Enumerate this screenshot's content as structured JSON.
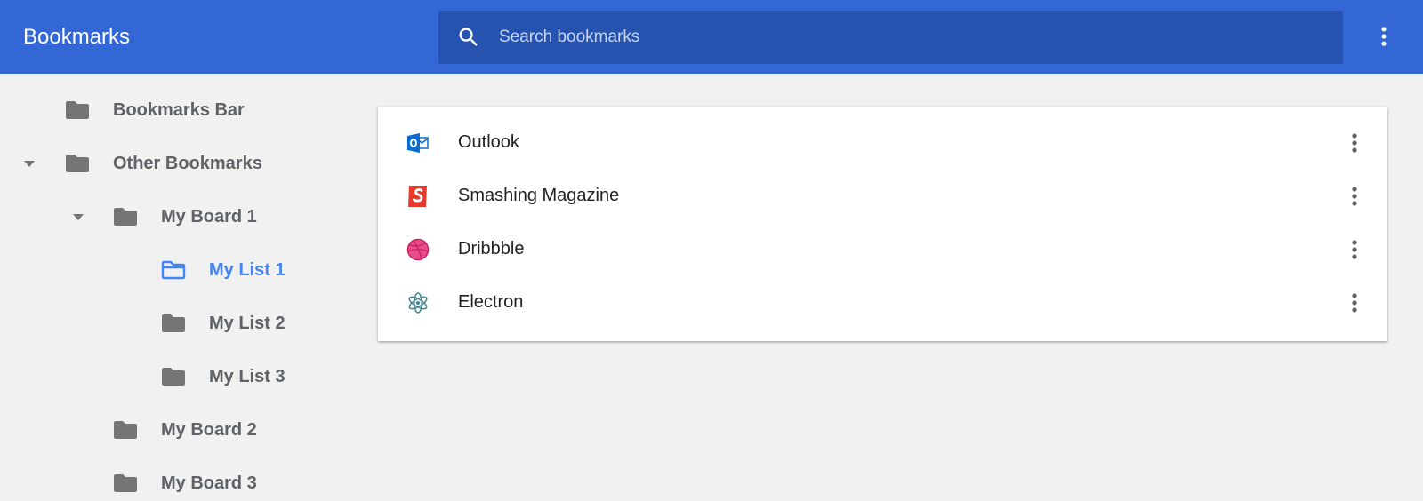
{
  "header": {
    "title": "Bookmarks",
    "search_placeholder": "Search bookmarks",
    "search_value": "",
    "search_icon": "search-icon",
    "menu_icon": "more-vert-icon"
  },
  "colors": {
    "header_bg": "#3367d6",
    "search_bg": "#2753b0",
    "selected_accent": "#4285f4",
    "folder_gray": "#757575",
    "page_bg": "#f1f1f1"
  },
  "sidebar": {
    "items": [
      {
        "label": "Bookmarks Bar",
        "level": 0,
        "expanded": false,
        "selected": false
      },
      {
        "label": "Other Bookmarks",
        "level": 0,
        "expanded": true,
        "selected": false
      },
      {
        "label": "My Board 1",
        "level": 1,
        "expanded": true,
        "selected": false
      },
      {
        "label": "My List 1",
        "level": 2,
        "expanded": false,
        "selected": true
      },
      {
        "label": "My List 2",
        "level": 2,
        "expanded": false,
        "selected": false
      },
      {
        "label": "My List 3",
        "level": 2,
        "expanded": false,
        "selected": false
      },
      {
        "label": "My Board 2",
        "level": 1,
        "expanded": false,
        "selected": false
      },
      {
        "label": "My Board 3",
        "level": 1,
        "expanded": false,
        "selected": false
      }
    ]
  },
  "bookmarks": {
    "items": [
      {
        "title": "Outlook",
        "icon": "outlook-icon"
      },
      {
        "title": "Smashing Magazine",
        "icon": "smashing-magazine-icon"
      },
      {
        "title": "Dribbble",
        "icon": "dribbble-icon"
      },
      {
        "title": "Electron",
        "icon": "electron-icon"
      }
    ]
  }
}
